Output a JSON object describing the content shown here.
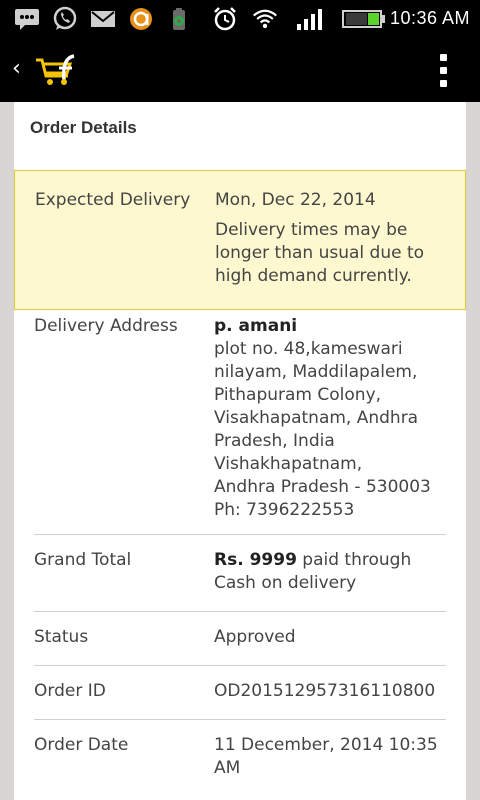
{
  "status_bar": {
    "time": "10:36 AM",
    "icons": [
      "message-icon",
      "whatsapp-icon",
      "gmail-icon",
      "app-icon",
      "battery-app-icon",
      "alarm-icon",
      "wifi-icon",
      "signal-icon",
      "battery-icon"
    ]
  },
  "app_bar": {
    "back_glyph": "‹",
    "logo": "flipkart-logo-icon",
    "menu": "overflow-menu-icon"
  },
  "order": {
    "title": "Order Details",
    "expected_delivery": {
      "label": "Expected Delivery",
      "date": "Mon, Dec 22, 2014",
      "note": "Delivery times may be longer than usual due to high demand currently."
    },
    "address": {
      "label": "Delivery Address",
      "name": "p. amani",
      "lines": [
        "plot no. 48,kameswari",
        "nilayam, Maddilapalem,",
        "Pithapuram Colony,",
        "Visakhapatnam, Andhra",
        "Pradesh, India",
        "Vishakhapatnam,",
        "Andhra Pradesh - 530003",
        "Ph: 7396222553"
      ]
    },
    "grand_total": {
      "label": "Grand Total",
      "amount": "Rs. 9999",
      "text": " paid through Cash on delivery"
    },
    "status": {
      "label": "Status",
      "value": "Approved"
    },
    "order_id": {
      "label": "Order ID",
      "value": "OD201512957316110800"
    },
    "order_date": {
      "label": "Order Date",
      "value": "11 December, 2014 10:35 AM"
    }
  },
  "colors": {
    "highlight_bg": "#fdf8cf",
    "highlight_border": "#e8c832",
    "logo_yellow": "#f5c400"
  }
}
